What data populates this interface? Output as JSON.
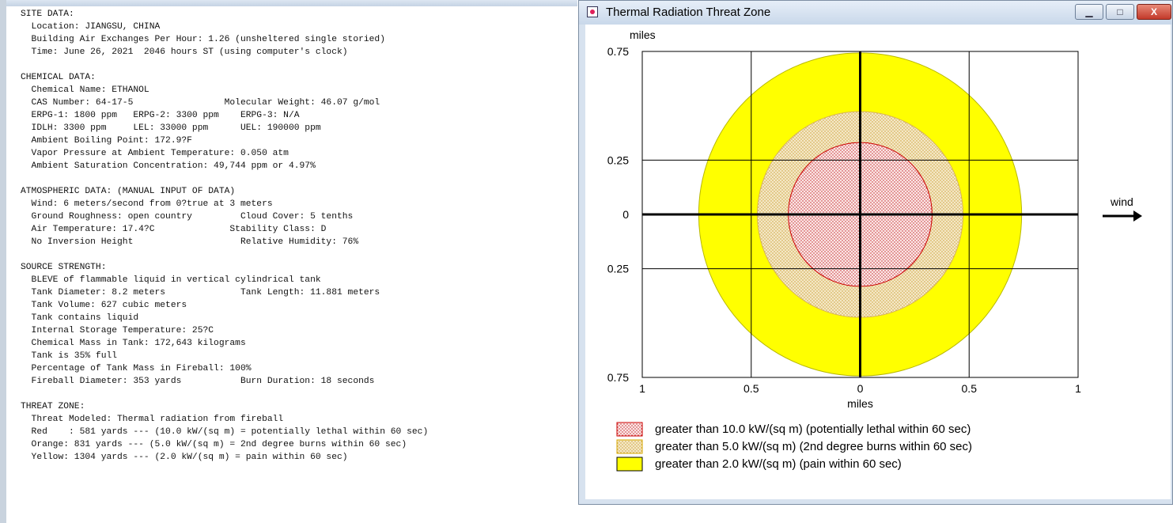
{
  "summary": {
    "lines": [
      "SITE DATA:",
      "  Location: JIANGSU, CHINA",
      "  Building Air Exchanges Per Hour: 1.26 (unsheltered single storied)",
      "  Time: June 26, 2021  2046 hours ST (using computer's clock)",
      "",
      "CHEMICAL DATA:",
      "  Chemical Name: ETHANOL",
      "  CAS Number: 64-17-5                 Molecular Weight: 46.07 g/mol",
      "  ERPG-1: 1800 ppm   ERPG-2: 3300 ppm    ERPG-3: N/A",
      "  IDLH: 3300 ppm     LEL: 33000 ppm      UEL: 190000 ppm",
      "  Ambient Boiling Point: 172.9?F",
      "  Vapor Pressure at Ambient Temperature: 0.050 atm",
      "  Ambient Saturation Concentration: 49,744 ppm or 4.97%",
      "",
      "ATMOSPHERIC DATA: (MANUAL INPUT OF DATA)",
      "  Wind: 6 meters/second from 0?true at 3 meters",
      "  Ground Roughness: open country         Cloud Cover: 5 tenths",
      "  Air Temperature: 17.4?C              Stability Class: D",
      "  No Inversion Height                    Relative Humidity: 76%",
      "",
      "SOURCE STRENGTH:",
      "  BLEVE of flammable liquid in vertical cylindrical tank",
      "  Tank Diameter: 8.2 meters              Tank Length: 11.881 meters",
      "  Tank Volume: 627 cubic meters",
      "  Tank contains liquid",
      "  Internal Storage Temperature: 25?C",
      "  Chemical Mass in Tank: 172,643 kilograms",
      "  Tank is 35% full",
      "  Percentage of Tank Mass in Fireball: 100%",
      "  Fireball Diameter: 353 yards           Burn Duration: 18 seconds",
      "",
      "THREAT ZONE:",
      "  Threat Modeled: Thermal radiation from fireball",
      "  Red    : 581 yards --- (10.0 kW/(sq m) = potentially lethal within 60 sec)",
      "  Orange: 831 yards --- (5.0 kW/(sq m) = 2nd degree burns within 60 sec)",
      "  Yellow: 1304 yards --- (2.0 kW/(sq m) = pain within 60 sec)"
    ]
  },
  "window": {
    "title": "Thermal Radiation Threat Zone",
    "minimize_glyph": "▁",
    "maximize_glyph": "□",
    "close_glyph": "X"
  },
  "chart_data": {
    "type": "threat-zone-map",
    "ylabel": "miles",
    "xlabel": "miles",
    "y_ticks": [
      "0.75",
      "0.25",
      "0",
      "0.25",
      "0.75"
    ],
    "x_ticks": [
      "1",
      "0.5",
      "0",
      "0.5",
      "1"
    ],
    "xlim": [
      -1,
      1
    ],
    "ylim": [
      -0.75,
      0.75
    ],
    "wind_label": "wind",
    "zones": [
      {
        "name": "greater than 2.0 kW/(sq m) (pain within 60 sec)",
        "radius_miles": 0.741,
        "radius_yards": 1304,
        "color": "#ffff00",
        "pattern": "solid"
      },
      {
        "name": "greater than 5.0 kW/(sq m) (2nd degree burns within 60 sec)",
        "radius_miles": 0.472,
        "radius_yards": 831,
        "color": "#ead9b0",
        "pattern": "dotted"
      },
      {
        "name": "greater than 10.0 kW/(sq m) (potentially lethal within 60 sec)",
        "radius_miles": 0.33,
        "radius_yards": 581,
        "color": "#f8d8d8",
        "pattern": "dotted",
        "stroke": "#cc0000"
      }
    ],
    "legend": [
      {
        "label": "greater than 10.0 kW/(sq m) (potentially lethal within 60 sec)",
        "color": "#f8d8d8",
        "border": "#cc0000"
      },
      {
        "label": "greater than 5.0 kW/(sq m) (2nd degree burns within 60 sec)",
        "color": "#ead9b0",
        "border": "#d8a800"
      },
      {
        "label": "greater than 2.0 kW/(sq m) (pain within 60 sec)",
        "color": "#ffff00",
        "border": "#000000"
      }
    ]
  }
}
